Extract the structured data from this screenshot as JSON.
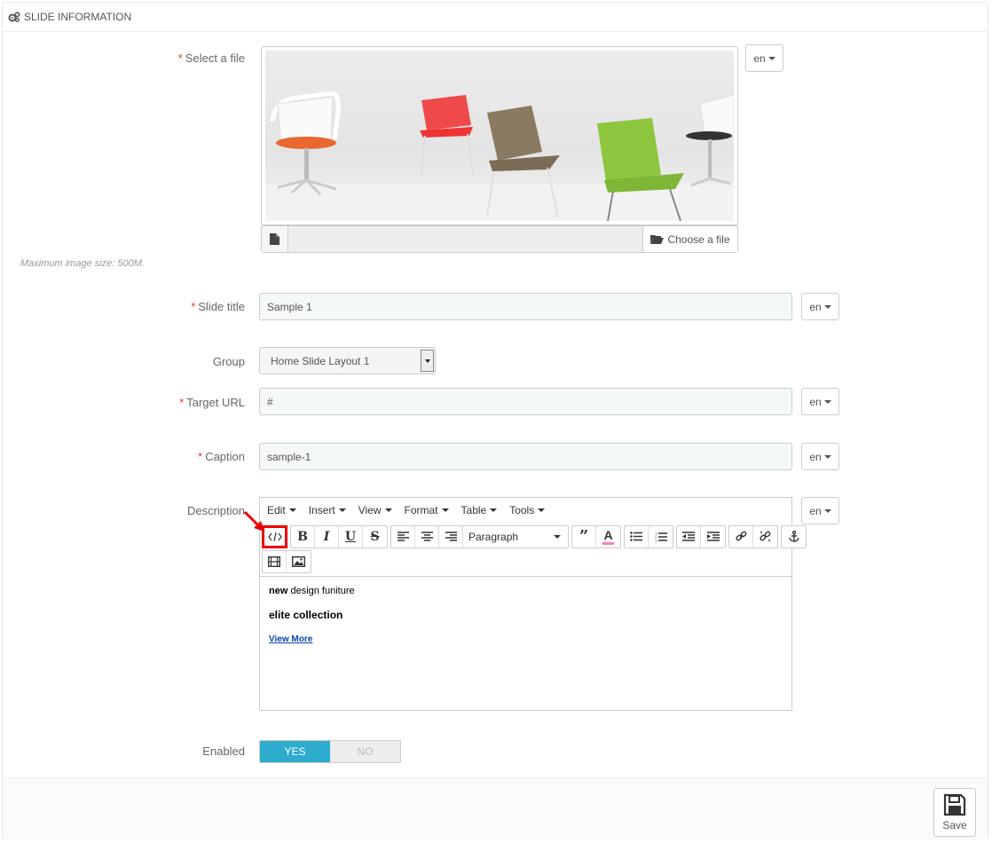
{
  "panel": {
    "title": "SLIDE INFORMATION",
    "icon": "gears-icon"
  },
  "file": {
    "label": "Select a file",
    "lang": "en",
    "choose_label": "Choose a file",
    "hint": "Maximum image size: 500M."
  },
  "slide_title": {
    "label": "Slide title",
    "value": "Sample 1",
    "lang": "en"
  },
  "group": {
    "label": "Group",
    "selected": "Home Slide Layout 1"
  },
  "target_url": {
    "label": "Target URL",
    "value": "#",
    "lang": "en"
  },
  "caption": {
    "label": "Caption",
    "value": "sample-1",
    "lang": "en"
  },
  "description": {
    "label": "Description",
    "lang": "en",
    "menu": [
      "Edit",
      "Insert",
      "View",
      "Format",
      "Table",
      "Tools"
    ],
    "block_format": "Paragraph",
    "content": {
      "line1_bold": "new",
      "line1_rest": " design funiture",
      "line2": "elite collection",
      "link": "View More"
    }
  },
  "enabled": {
    "label": "Enabled",
    "yes": "YES",
    "no": "NO",
    "value": "YES"
  },
  "save": {
    "label": "Save"
  },
  "colors": {
    "accent": "#2eacce",
    "required": "#e32222",
    "highlight": "#e00000"
  }
}
